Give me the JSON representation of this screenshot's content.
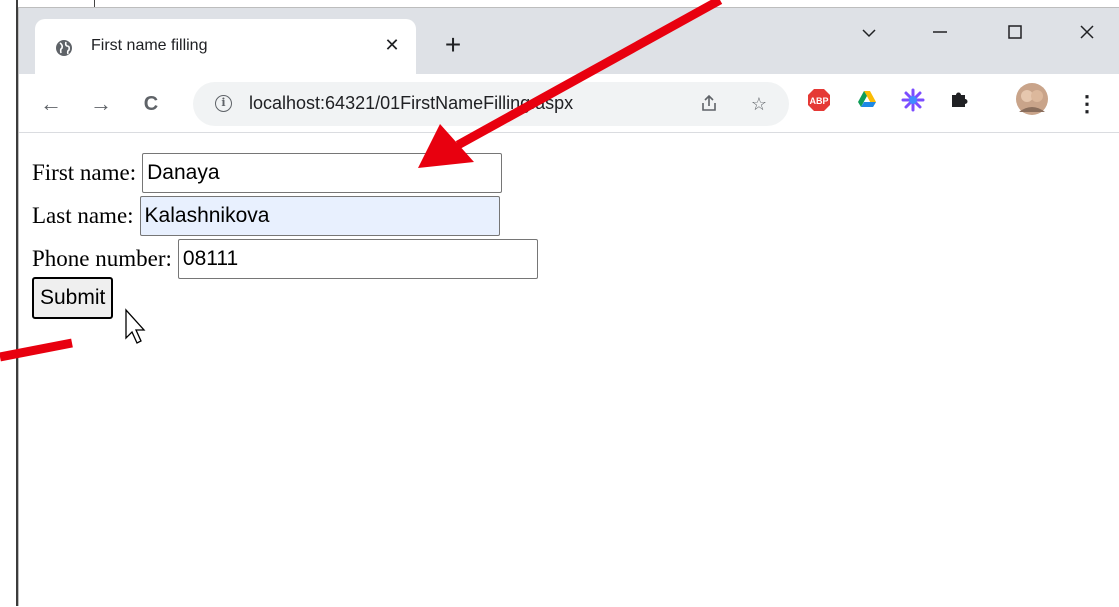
{
  "browser": {
    "tab": {
      "title": "First name filling",
      "close_label": "✕",
      "favicon": "globe-icon"
    },
    "new_tab_label": "+",
    "window_controls": {
      "tab_search": "⌵",
      "minimize": "—",
      "maximize": "☐",
      "close": "✕"
    },
    "toolbar": {
      "back": "←",
      "forward": "→",
      "reload": "C",
      "info_icon_label": "i",
      "url": "localhost:64321/01FirstNameFilling.aspx",
      "share_icon": "share-icon",
      "bookmark_icon": "star-icon",
      "extensions": [
        {
          "name": "adblock-plus-icon",
          "label": "ABP",
          "color": "#e53935"
        },
        {
          "name": "google-drive-icon",
          "color": "#1e88e5"
        },
        {
          "name": "extension-sparkle-icon",
          "color": "#7c4dff"
        },
        {
          "name": "puzzle-icon",
          "color": "#202124"
        }
      ],
      "menu_label": "⋮"
    }
  },
  "form": {
    "first_name": {
      "label": "First name:",
      "value": "Danaya"
    },
    "last_name": {
      "label": "Last name:",
      "value": "Kalashnikova"
    },
    "phone": {
      "label": "Phone number:",
      "value": "08111"
    },
    "submit_label": "Submit"
  },
  "colors": {
    "arrow": "#e8000f",
    "titlebar": "#dee1e6",
    "autofill": "#e8f0fe"
  }
}
